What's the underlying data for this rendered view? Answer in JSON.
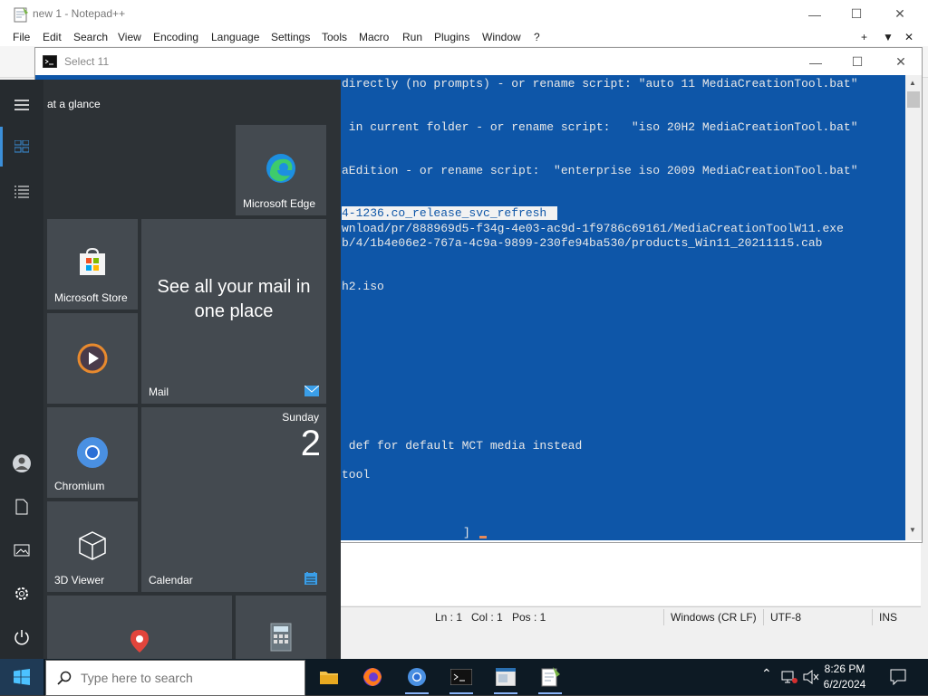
{
  "npp": {
    "title": "new 1 - Notepad++",
    "menu": [
      "File",
      "Edit",
      "Search",
      "View",
      "Encoding",
      "Language",
      "Settings",
      "Tools",
      "Macro",
      "Run",
      "Plugins",
      "Window",
      "?"
    ],
    "menu_right": [
      "+",
      "▼",
      "✕"
    ],
    "status": {
      "ln": "Ln : 1",
      "col": "Col : 1",
      "pos": "Pos : 1",
      "eol": "Windows (CR LF)",
      "enc": "UTF-8",
      "mode": "INS"
    }
  },
  "console": {
    "title": "Select 11",
    "lines": [
      "directly (no prompts) - or rename script: \"auto 11 MediaCreationTool.bat\"",
      " in current folder - or rename script:   \"iso 20H2 MediaCreationTool.bat\"",
      "aEdition - or rename script:  \"enterprise iso 2009 MediaCreationTool.bat\"",
      "4-1236.co_release_svc_refresh ",
      "wnload/pr/888969d5-f34g-4e03-ac9d-1f9786c69161/MediaCreationToolW11.exe",
      "b/4/1b4e06e2-767a-4c9a-9899-230fe94ba530/products_Win11_20211115.cab",
      "h2.iso",
      " def for default MCT media instead",
      "tool",
      "]"
    ]
  },
  "start": {
    "section": "at a glance",
    "tiles": {
      "edge": "Microsoft Edge",
      "store": "Microsoft Store",
      "mail_promo": "See all your mail in one place",
      "mail": "Mail",
      "chromium": "Chromium",
      "calendar_day": "Sunday",
      "calendar_date": "2",
      "viewer": "3D Viewer",
      "calendar": "Calendar"
    }
  },
  "taskbar": {
    "search_placeholder": "Type here to search",
    "time": "8:26 PM",
    "date": "6/2/2024"
  },
  "colors": {
    "console_bg": "#0e56a8",
    "start_bg": "#2d3236",
    "tile_bg": "#444a50",
    "taskbar_bg": "#0d1a24"
  }
}
